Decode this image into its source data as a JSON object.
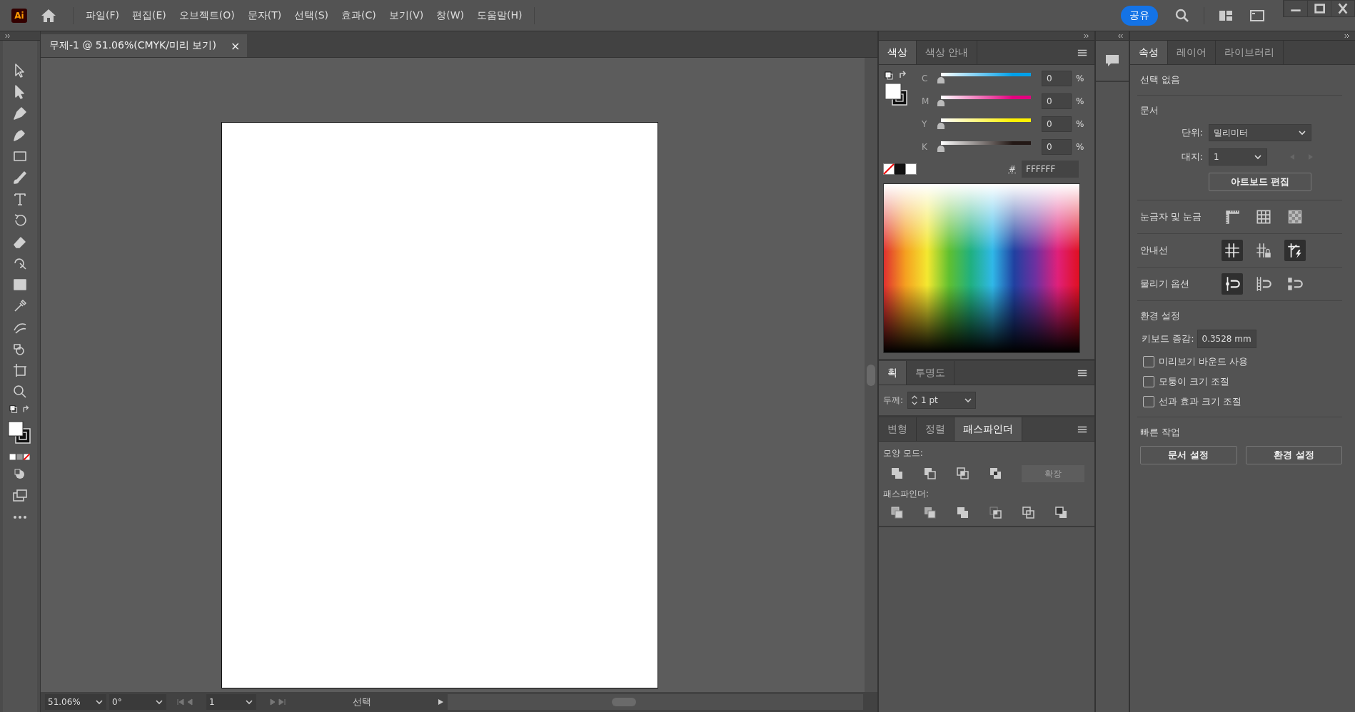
{
  "app": {
    "logo": "Ai",
    "share": "공유"
  },
  "menu": [
    "파일(F)",
    "편집(E)",
    "오브젝트(O)",
    "문자(T)",
    "선택(S)",
    "효과(C)",
    "보기(V)",
    "창(W)",
    "도움말(H)"
  ],
  "document_tab": {
    "title": "무제-1 @ 51.06%(CMYK/미리 보기)",
    "close": "×"
  },
  "color_panel": {
    "tabs": [
      {
        "label": "색상",
        "selected": true
      },
      {
        "label": "색상 안내",
        "selected": false
      }
    ],
    "sliders": [
      {
        "label": "C",
        "value": "0",
        "unit": "%",
        "level": 0,
        "color": "#00a0e9"
      },
      {
        "label": "M",
        "value": "0",
        "unit": "%",
        "level": 0,
        "color": "#e4007f"
      },
      {
        "label": "Y",
        "value": "0",
        "unit": "%",
        "level": 0,
        "color": "#fff100"
      },
      {
        "label": "K",
        "value": "0",
        "unit": "%",
        "level": 0,
        "color": "#231815"
      }
    ],
    "hex_label": "#",
    "hex": "FFFFFF"
  },
  "stroke_panel": {
    "tabs": [
      {
        "label": "획",
        "selected": true
      },
      {
        "label": "투명도",
        "selected": false
      }
    ],
    "weight_label": "두께:",
    "weight": "1 pt"
  },
  "pathfinder_panel": {
    "tabs": [
      {
        "label": "변형",
        "selected": false
      },
      {
        "label": "정렬",
        "selected": false
      },
      {
        "label": "패스파인더",
        "selected": true
      }
    ],
    "shape_modes_label": "모양 모드:",
    "expand": {
      "label": "확장",
      "disabled": true
    },
    "pathfinders_label": "패스파인더:"
  },
  "properties": {
    "tabs": [
      {
        "label": "속성",
        "selected": true
      },
      {
        "label": "레이어",
        "selected": false
      },
      {
        "label": "라이브러리",
        "selected": false
      }
    ],
    "selection": "선택 없음",
    "document_heading": "문서",
    "units_label": "단위:",
    "units": "밀리미터",
    "artboard_label": "대지:",
    "artboard": "1",
    "edit_artboards": "아트보드 편집",
    "rulers_label": "눈금자 및 눈금",
    "guides_label": "안내선",
    "guides": [
      {
        "on": true
      },
      {
        "on": false
      },
      {
        "on": true
      }
    ],
    "snap_label": "물리기 옵션",
    "snap": [
      {
        "on": true
      },
      {
        "on": false
      },
      {
        "on": false
      }
    ],
    "preferences_heading": "환경 설정",
    "keyboard_label": "키보드 증감:",
    "keyboard": "0.3528 mm",
    "checkboxes": [
      {
        "label": "미리보기 바운드 사용",
        "checked": false
      },
      {
        "label": "모퉁이 크기 조절",
        "checked": false
      },
      {
        "label": "선과 효과 크기 조절",
        "checked": false
      }
    ],
    "quick_heading": "빠른 작업",
    "quick_buttons": [
      "문서 설정",
      "환경 설정"
    ]
  },
  "status_bar": {
    "zoom": "51.06%",
    "rotation": "0°",
    "artboard": "1",
    "tool": "선택"
  }
}
